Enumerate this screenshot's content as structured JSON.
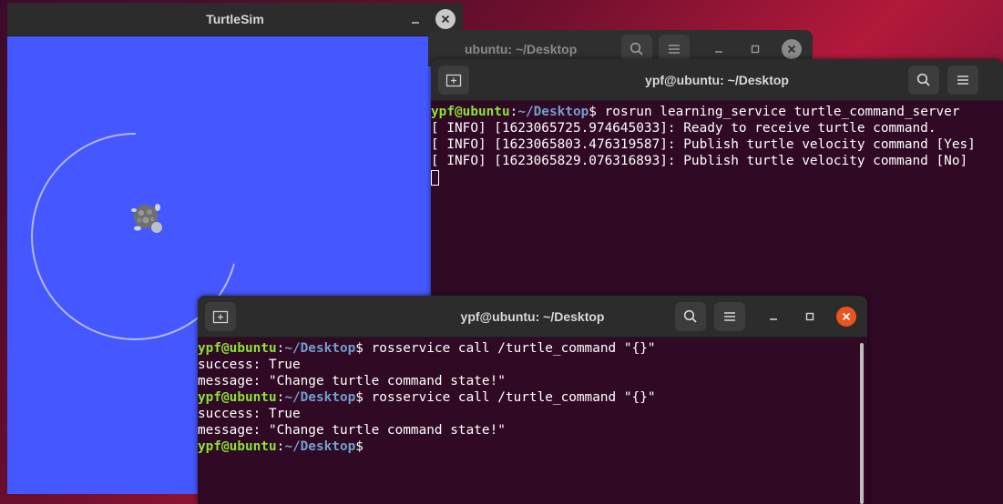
{
  "turtlesim": {
    "title": "TurtleSim",
    "canvas_color": "#4557ff",
    "trail_color": "#b3b8ff"
  },
  "back_terminal": {
    "title": "ubuntu: ~/Desktop"
  },
  "server_terminal": {
    "title": "ypf@ubuntu: ~/Desktop",
    "lines": [
      {
        "user": "ypf@ubuntu",
        "sep": ":",
        "path": "~/Desktop",
        "prompt": "$",
        "cmd": " rosrun learning_service turtle_command_server"
      },
      {
        "text": "[ INFO] [1623065725.974645033]: Ready to receive turtle command."
      },
      {
        "text": "[ INFO] [1623065803.476319587]: Publish turtle velocity command [Yes]"
      },
      {
        "text": "[ INFO] [1623065829.076316893]: Publish turtle velocity command [No]"
      }
    ]
  },
  "client_terminal": {
    "title": "ypf@ubuntu: ~/Desktop",
    "lines": [
      {
        "user": "ypf@ubuntu",
        "sep": ":",
        "path": "~/Desktop",
        "prompt": "$",
        "cmd": " rosservice call /turtle_command \"{}\""
      },
      {
        "text": "success: True"
      },
      {
        "text": "message: \"Change turtle command state!\""
      },
      {
        "user": "ypf@ubuntu",
        "sep": ":",
        "path": "~/Desktop",
        "prompt": "$",
        "cmd": " rosservice call /turtle_command \"{}\""
      },
      {
        "text": "success: True"
      },
      {
        "text": "message: \"Change turtle command state!\""
      },
      {
        "user": "ypf@ubuntu",
        "sep": ":",
        "path": "~/Desktop",
        "prompt": "$",
        "cmd": ""
      }
    ]
  },
  "colors": {
    "terminal_bg": "#300a24",
    "prompt_user": "#8ae234",
    "prompt_path": "#729fcf",
    "close_button": "#e95420"
  },
  "icons": {
    "new_tab": "new-tab-icon",
    "search": "search-icon",
    "menu": "hamburger-menu-icon",
    "minimize": "minimize-icon",
    "maximize": "maximize-icon",
    "close": "close-icon"
  }
}
